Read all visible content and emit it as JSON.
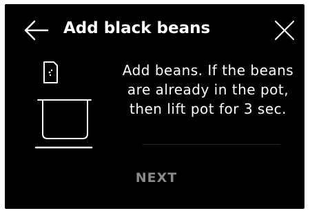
{
  "header": {
    "title": "Add black beans",
    "back_icon": "arrow-left-icon",
    "close_icon": "close-icon"
  },
  "step": {
    "instruction": "Add beans. If the beans are already in the pot, then lift pot for 3 sec.",
    "illustration_icon": "ingredient-into-pot-icon"
  },
  "actions": {
    "next_label": "NEXT"
  },
  "colors": {
    "background": "#000000",
    "text": "#ffffff",
    "disabled_text": "#8a8a8a"
  }
}
